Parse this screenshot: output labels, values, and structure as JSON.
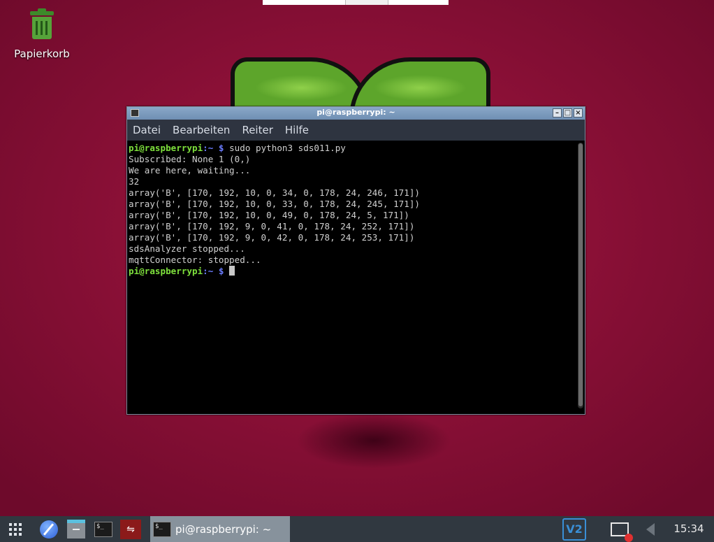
{
  "desktop": {
    "trash_label": "Papierkorb"
  },
  "terminal": {
    "window_title": "pi@raspberrypi: ~",
    "menu": [
      "Datei",
      "Bearbeiten",
      "Reiter",
      "Hilfe"
    ],
    "prompt_user": "pi@raspberrypi",
    "prompt_path": ":~ $",
    "command": " sudo python3 sds011.py",
    "output": [
      "Subscribed: None 1 (0,)",
      "We are here, waiting...",
      "32",
      "array('B', [170, 192, 10, 0, 34, 0, 178, 24, 246, 171])",
      "array('B', [170, 192, 10, 0, 33, 0, 178, 24, 245, 171])",
      "array('B', [170, 192, 10, 0, 49, 0, 178, 24, 5, 171])",
      "array('B', [170, 192, 9, 0, 41, 0, 178, 24, 252, 171])",
      "array('B', [170, 192, 9, 0, 42, 0, 178, 24, 253, 171])",
      "sdsAnalyzer stopped...",
      "mqttConnector: stopped..."
    ]
  },
  "taskbar": {
    "terminal_glyph": "$_",
    "mqtt_glyph": "⇋",
    "task_title": "pi@raspberrypi: ~",
    "vnc_label": "V2",
    "clock": "15:34"
  }
}
